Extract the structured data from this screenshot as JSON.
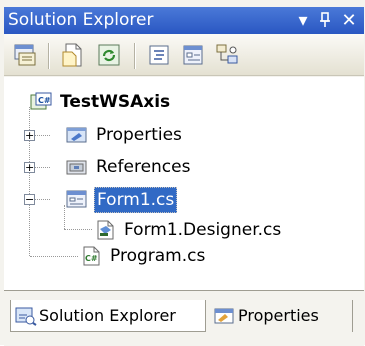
{
  "window": {
    "title": "Solution Explorer",
    "controls": {
      "dropdown": "▾",
      "pin": "ᵖ",
      "close": "✕"
    }
  },
  "toolbar": {
    "icons": [
      "properties-icon",
      "show-all-files-icon",
      "refresh-icon",
      "view-code-icon",
      "view-designer-icon",
      "class-diagram-icon"
    ]
  },
  "tree": {
    "project": "TestWSAxis",
    "items": [
      {
        "label": "Properties",
        "expander": "+"
      },
      {
        "label": "References",
        "expander": "+"
      },
      {
        "label": "Form1.cs",
        "expander": "−"
      },
      {
        "label": "Form1.Designer.cs"
      },
      {
        "label": "Program.cs"
      }
    ]
  },
  "tabs": {
    "solution_explorer": "Solution Explorer",
    "properties": "Properties"
  },
  "colors": {
    "title_bar": "#2a57c2",
    "selection": "#316ac5"
  }
}
